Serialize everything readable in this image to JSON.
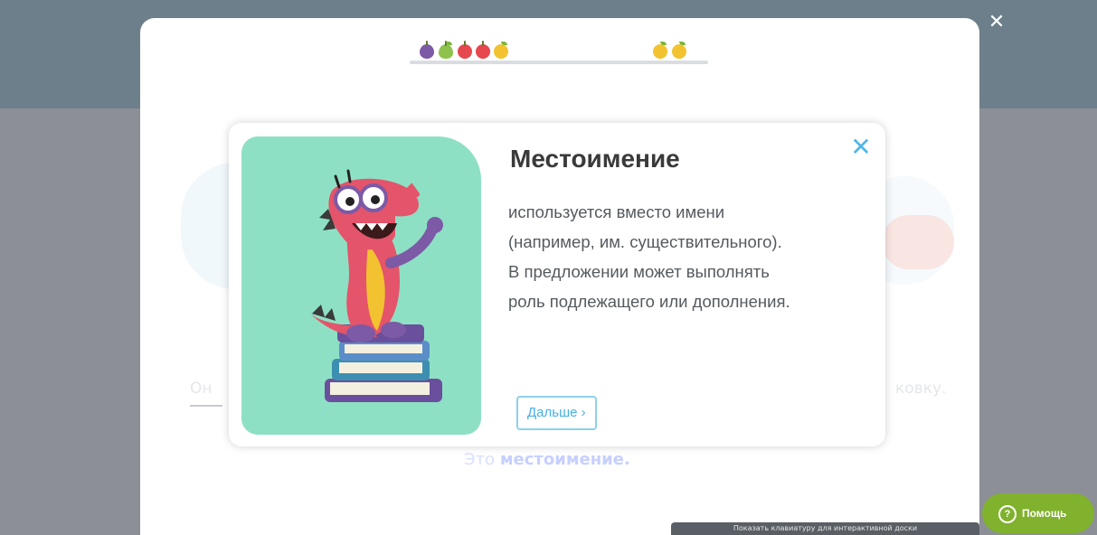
{
  "window": {
    "close_symbol": "✕"
  },
  "progress": {
    "fruits": [
      {
        "kind": "plum",
        "color": "#7c5aa6"
      },
      {
        "kind": "pear",
        "color": "#8fc24d"
      },
      {
        "kind": "apple",
        "color": "#e5484d"
      },
      {
        "kind": "apple",
        "color": "#e5484d"
      },
      {
        "kind": "lemon",
        "color": "#f2c230"
      },
      {
        "kind": "lemon",
        "color": "#f2c230"
      },
      {
        "kind": "lemon",
        "color": "#f2c230"
      }
    ]
  },
  "background_lesson": {
    "sentence_start": "Он",
    "sentence_end": "ковку.",
    "caption_prefix": "Это",
    "caption_term": "местоимение."
  },
  "popup": {
    "title": "Местоимение",
    "description_lines": [
      "используется вместо имени",
      "(например, им. существительного).",
      "В предложении может выполнять",
      "роль подлежащего или дополнения."
    ],
    "next_label": "Дальше ›",
    "close_symbol": "✕",
    "illustration": "dinosaur-on-books"
  },
  "help": {
    "label": "Помощь",
    "icon": "?"
  },
  "keyboard_bar": {
    "label": "Показать клавиатуру для интерактивной доски"
  },
  "colors": {
    "accent_blue": "#49b0e0",
    "mint": "#8ee0c4",
    "help_green": "#80b22d"
  }
}
